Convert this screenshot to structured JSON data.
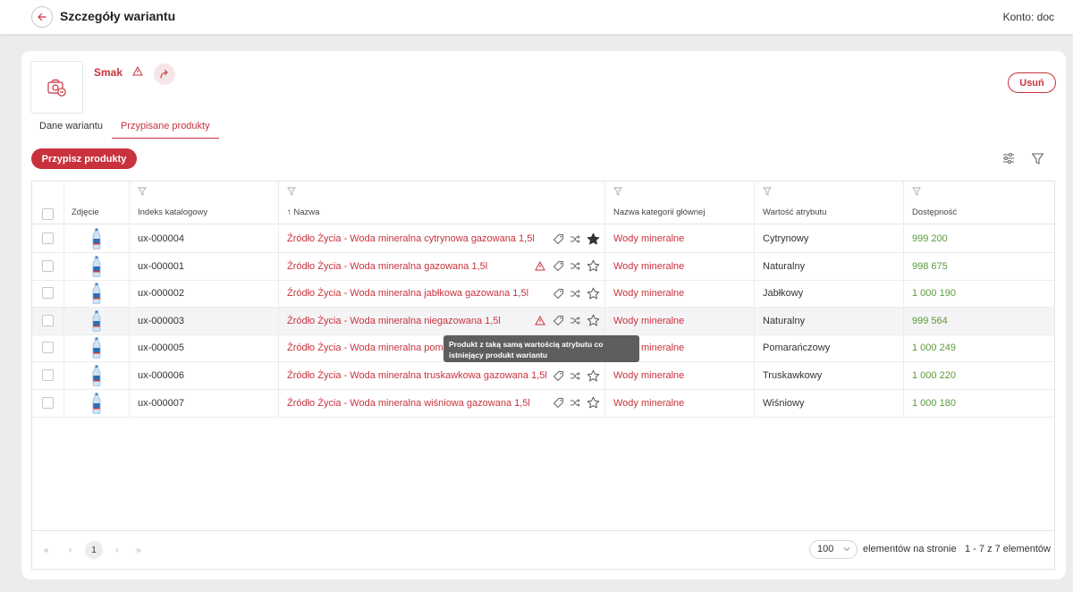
{
  "header": {
    "title": "Szczegóły wariantu",
    "account": "Konto: doc"
  },
  "variant": {
    "name": "Smak",
    "delete_label": "Usuń"
  },
  "tabs": [
    {
      "label": "Dane wariantu"
    },
    {
      "label": "Przypisane produkty"
    }
  ],
  "toolbar": {
    "assign_label": "Przypisz produkty"
  },
  "table": {
    "columns": [
      "Zdjęcie",
      "Indeks katalogowy",
      "↑ Nazwa",
      "Nazwa kategorii głównej",
      "Wartość atrybutu",
      "Dostępność"
    ],
    "rows": [
      {
        "index": "ux-000004",
        "name": "Źródło Życia - Woda mineralna cytrynowa gazowana 1,5l",
        "category": "Wody mineralne",
        "attr": "Cytrynowy",
        "avail": "999 200",
        "warning": false,
        "starred": true
      },
      {
        "index": "ux-000001",
        "name": "Źródło Życia - Woda mineralna gazowana 1,5l",
        "category": "Wody mineralne",
        "attr": "Naturalny",
        "avail": "998 675",
        "warning": true,
        "starred": false
      },
      {
        "index": "ux-000002",
        "name": "Źródło Życia - Woda mineralna jabłkowa gazowana 1,5l",
        "category": "Wody mineralne",
        "attr": "Jabłkowy",
        "avail": "1 000 190",
        "warning": false,
        "starred": false
      },
      {
        "index": "ux-000003",
        "name": "Źródło Życia - Woda mineralna niegazowana 1,5l",
        "category": "Wody mineralne",
        "attr": "Naturalny",
        "avail": "999 564",
        "warning": true,
        "starred": false
      },
      {
        "index": "ux-000005",
        "name": "Źródło Życia - Woda mineralna pomarańczowa gazowana 1,5l",
        "category": "Wody mineralne",
        "attr": "Pomarańczowy",
        "avail": "1 000 249",
        "warning": false,
        "starred": false
      },
      {
        "index": "ux-000006",
        "name": "Źródło Życia - Woda mineralna truskawkowa gazowana 1,5l",
        "category": "Wody mineralne",
        "attr": "Truskawkowy",
        "avail": "1 000 220",
        "warning": false,
        "starred": false
      },
      {
        "index": "ux-000007",
        "name": "Źródło Życia - Woda mineralna wiśniowa gazowana 1,5l",
        "category": "Wody mineralne",
        "attr": "Wiśniowy",
        "avail": "1 000 180",
        "warning": false,
        "starred": false
      }
    ]
  },
  "tooltip": {
    "text": "Produkt z taką samą wartością atrybutu co istniejący produkt wariantu"
  },
  "pagination": {
    "current_page": "1",
    "page_size": "100",
    "per_page_label": "elementów na stronie",
    "range": "1 - 7 z 7 elementów"
  },
  "colors": {
    "accent": "#c8323c",
    "available": "#5a9a3a"
  }
}
